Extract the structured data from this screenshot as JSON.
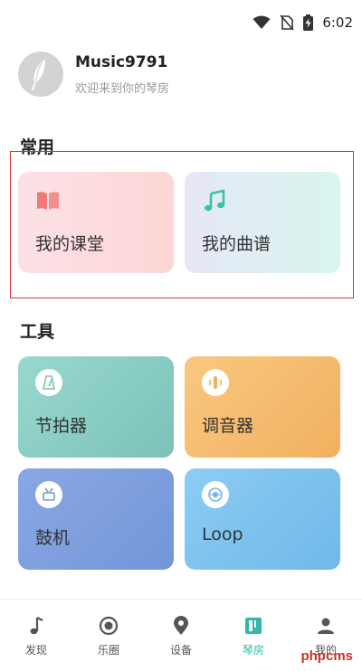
{
  "status_bar": {
    "time": "6:02"
  },
  "profile": {
    "username": "Music9791",
    "welcome": "欢迎来到你的琴房"
  },
  "sections": {
    "common": "常用",
    "tools": "工具"
  },
  "common_cards": [
    {
      "label": "我的课堂",
      "icon": "book-icon",
      "icon_color": "#f07a7a"
    },
    {
      "label": "我的曲谱",
      "icon": "music-note-icon",
      "icon_color": "#36c5a8"
    }
  ],
  "tool_cards": [
    {
      "label": "节拍器",
      "icon": "metronome-icon",
      "color": "#8fd2c8"
    },
    {
      "label": "调音器",
      "icon": "tuner-icon",
      "color": "#f5bd72"
    },
    {
      "label": "鼓机",
      "icon": "drum-icon",
      "color": "#7f9fde"
    },
    {
      "label": "Loop",
      "icon": "loop-icon",
      "color": "#7fc2ee"
    }
  ],
  "tabbar": {
    "items": [
      {
        "label": "发现",
        "icon": "music-note-icon"
      },
      {
        "label": "乐圈",
        "icon": "circle-icon"
      },
      {
        "label": "设备",
        "icon": "location-pin-icon"
      },
      {
        "label": "琴房",
        "icon": "piano-room-icon",
        "active": true
      },
      {
        "label": "我的",
        "icon": "person-icon"
      }
    ],
    "active_color": "#2fb9a9"
  },
  "watermark": "phpcms"
}
